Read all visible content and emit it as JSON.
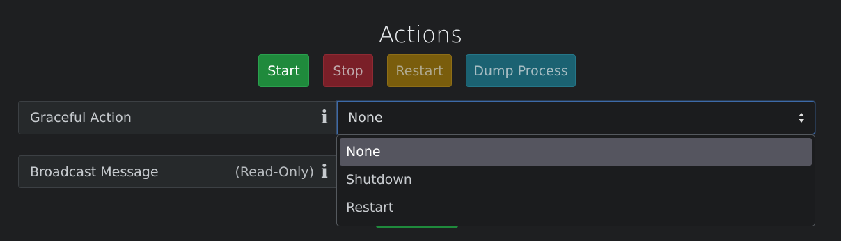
{
  "section": {
    "title": "Actions"
  },
  "buttons": {
    "start": "Start",
    "stop": "Stop",
    "restart": "Restart",
    "dump": "Dump Process"
  },
  "graceful": {
    "label": "Graceful Action",
    "selected": "None",
    "options": [
      "None",
      "Shutdown",
      "Restart"
    ]
  },
  "broadcast": {
    "label": "Broadcast Message",
    "note": "(Read-Only)"
  },
  "icons": {
    "info": "info-icon",
    "caret": "select-caret-icon"
  },
  "colors": {
    "background": "#1e1f21",
    "start": "#1f8a3c",
    "stop": "#7a1f28",
    "restart": "#7a5d0c",
    "dump": "#1b6272",
    "focus": "#3d6aa8"
  }
}
